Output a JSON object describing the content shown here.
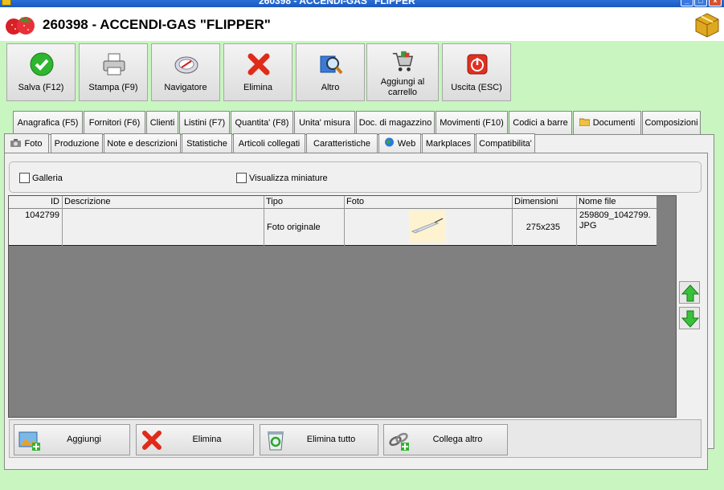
{
  "window": {
    "title": "260398 - ACCENDI-GAS \"FLIPPER\""
  },
  "header": {
    "title": "260398 - ACCENDI-GAS \"FLIPPER\"",
    "logo_icon": "strawberry-logo-icon",
    "app_icon": "package-box-icon"
  },
  "toolbar": [
    {
      "label": "Salva (F12)",
      "icon": "check-icon"
    },
    {
      "label": "Stampa (F9)",
      "icon": "printer-icon"
    },
    {
      "label": "Navigatore",
      "icon": "compass-icon"
    },
    {
      "label": "Elimina",
      "icon": "red-x-icon"
    },
    {
      "label": "Altro",
      "icon": "magnifier-book-icon"
    },
    {
      "label": "Aggiungi al carrello",
      "icon": "cart-icon"
    },
    {
      "label": "Uscita (ESC)",
      "icon": "power-icon"
    }
  ],
  "tabs_row1": [
    "Anagrafica (F5)",
    "Fornitori (F6)",
    "Clienti",
    "Listini (F7)",
    "Quantita' (F8)",
    "Unita' misura",
    "Doc. di magazzino",
    "Movimenti (F10)",
    "Codici a barre",
    "Documenti",
    "Composizioni"
  ],
  "tabs_row2": [
    "Foto",
    "Produzione",
    "Note e descrizioni",
    "Statistiche",
    "Articoli collegati",
    "Caratteristiche",
    "Web",
    "Markplaces",
    "Compatibilita'"
  ],
  "active_tab": "Foto",
  "options": {
    "galleria_label": "Galleria",
    "galleria_checked": false,
    "miniature_label": "Visualizza miniature",
    "miniature_checked": false
  },
  "grid": {
    "columns": [
      "ID",
      "Descrizione",
      "Tipo",
      "Foto",
      "Dimensioni",
      "Nome file"
    ],
    "rows": [
      {
        "id": "1042799",
        "descrizione": "",
        "tipo": "Foto originale",
        "foto": "thumbnail-image",
        "dimensioni": "275x235",
        "nome_file": "259809_1042799.JPG"
      }
    ]
  },
  "side_buttons": {
    "up_icon": "arrow-up-icon",
    "down_icon": "arrow-down-icon"
  },
  "bottom_buttons": [
    {
      "label": "Aggiungi",
      "icon": "add-image-icon"
    },
    {
      "label": "Elimina",
      "icon": "red-x-icon"
    },
    {
      "label": "Elimina tutto",
      "icon": "recycle-bin-icon"
    },
    {
      "label": "Collega altro",
      "icon": "link-add-icon"
    }
  ],
  "colors": {
    "background": "#c8f5c0",
    "titlebar": "#1c58c0",
    "grid_background": "#808080"
  }
}
